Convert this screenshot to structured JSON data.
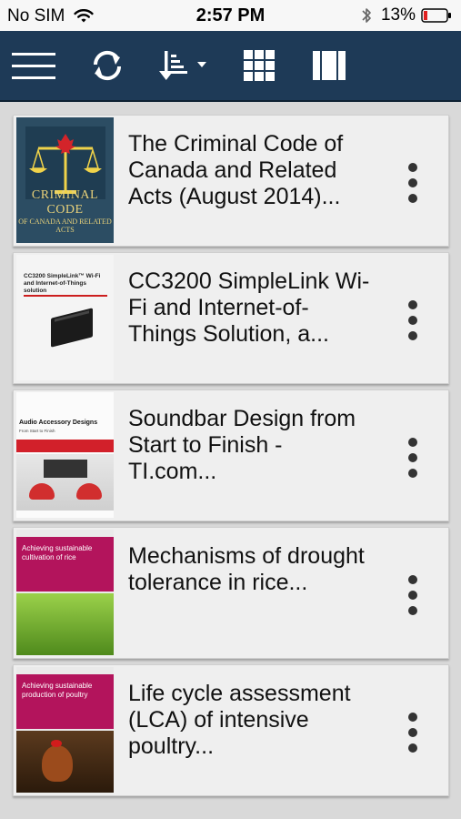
{
  "status_bar": {
    "carrier": "No SIM",
    "time": "2:57 PM",
    "battery": "13%"
  },
  "toolbar": {
    "icons": [
      "menu-icon",
      "sync-icon",
      "sort-icon",
      "grid-view-icon",
      "list-view-icon"
    ]
  },
  "documents": [
    {
      "title": "The Criminal Code of Canada and Related Acts (August 2014)...",
      "cover": "criminal-code-cover"
    },
    {
      "title": "CC3200 SimpleLink Wi-Fi and Internet-of-Things Solution, a...",
      "cover": "cc3200-cover"
    },
    {
      "title": "Soundbar Design from Start to Finish - TI.com...",
      "cover": "audio-accessory-cover"
    },
    {
      "title": "Mechanisms of drought tolerance in rice...",
      "cover": "rice-cover"
    },
    {
      "title": "Life cycle assessment (LCA) of intensive poultry...",
      "cover": "poultry-cover"
    }
  ],
  "colors": {
    "toolbar_bg": "#1e3a57",
    "page_bg": "#d9d9d9",
    "card_bg": "#efefef",
    "battery_low": "#e02020"
  }
}
